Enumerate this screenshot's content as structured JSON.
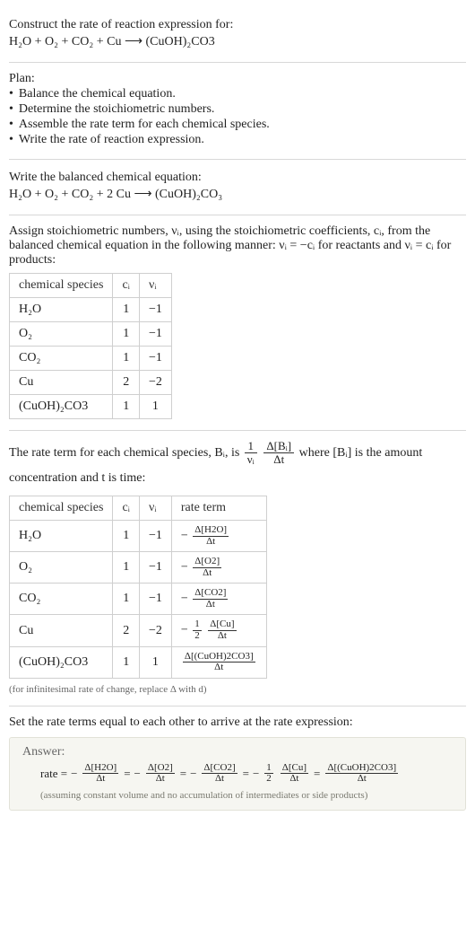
{
  "header": {
    "title": "Construct the rate of reaction expression for:",
    "equation": "H₂O + O₂ + CO₂ + Cu ⟶ (CuOH)₂CO3"
  },
  "plan": {
    "label": "Plan:",
    "items": [
      "Balance the chemical equation.",
      "Determine the stoichiometric numbers.",
      "Assemble the rate term for each chemical species.",
      "Write the rate of reaction expression."
    ]
  },
  "balanced": {
    "label": "Write the balanced chemical equation:",
    "equation": "H₂O + O₂ + CO₂ + 2 Cu ⟶ (CuOH)₂CO₃"
  },
  "stoich_intro": {
    "text_pre": "Assign stoichiometric numbers, νᵢ, using the stoichiometric coefficients, cᵢ, from the balanced chemical equation in the following manner: νᵢ = −cᵢ for reactants and νᵢ = cᵢ for products:"
  },
  "stoich_table": {
    "headers": [
      "chemical species",
      "cᵢ",
      "νᵢ"
    ],
    "rows": [
      {
        "species": "H₂O",
        "c": "1",
        "v": "−1"
      },
      {
        "species": "O₂",
        "c": "1",
        "v": "−1"
      },
      {
        "species": "CO₂",
        "c": "1",
        "v": "−1"
      },
      {
        "species": "Cu",
        "c": "2",
        "v": "−2"
      },
      {
        "species": "(CuOH)₂CO3",
        "c": "1",
        "v": "1"
      }
    ]
  },
  "rate_intro": {
    "pre": "The rate term for each chemical species, Bᵢ, is",
    "frac_left_n": "1",
    "frac_left_d": "νᵢ",
    "frac_right_n": "Δ[Bᵢ]",
    "frac_right_d": "Δt",
    "post": "where [Bᵢ] is the amount concentration and t is time:"
  },
  "rate_table": {
    "headers": [
      "chemical species",
      "cᵢ",
      "νᵢ",
      "rate term"
    ],
    "rows": [
      {
        "species": "H₂O",
        "c": "1",
        "v": "−1",
        "neg": "−",
        "half_n": "",
        "half_d": "",
        "n": "Δ[H2O]",
        "d": "Δt"
      },
      {
        "species": "O₂",
        "c": "1",
        "v": "−1",
        "neg": "−",
        "half_n": "",
        "half_d": "",
        "n": "Δ[O2]",
        "d": "Δt"
      },
      {
        "species": "CO₂",
        "c": "1",
        "v": "−1",
        "neg": "−",
        "half_n": "",
        "half_d": "",
        "n": "Δ[CO2]",
        "d": "Δt"
      },
      {
        "species": "Cu",
        "c": "2",
        "v": "−2",
        "neg": "−",
        "half_n": "1",
        "half_d": "2",
        "n": "Δ[Cu]",
        "d": "Δt"
      },
      {
        "species": "(CuOH)₂CO3",
        "c": "1",
        "v": "1",
        "neg": "",
        "half_n": "",
        "half_d": "",
        "n": "Δ[(CuOH)2CO3]",
        "d": "Δt"
      }
    ],
    "note": "(for infinitesimal rate of change, replace Δ with d)"
  },
  "final_intro": "Set the rate terms equal to each other to arrive at the rate expression:",
  "answer": {
    "label": "Answer:",
    "lead": "rate =",
    "terms": [
      {
        "neg": "−",
        "half_n": "",
        "half_d": "",
        "n": "Δ[H2O]",
        "d": "Δt"
      },
      {
        "neg": "−",
        "half_n": "",
        "half_d": "",
        "n": "Δ[O2]",
        "d": "Δt"
      },
      {
        "neg": "−",
        "half_n": "",
        "half_d": "",
        "n": "Δ[CO2]",
        "d": "Δt"
      },
      {
        "neg": "−",
        "half_n": "1",
        "half_d": "2",
        "n": "Δ[Cu]",
        "d": "Δt"
      },
      {
        "neg": "",
        "half_n": "",
        "half_d": "",
        "n": "Δ[(CuOH)2CO3]",
        "d": "Δt"
      }
    ],
    "eq": "=",
    "assumption": "(assuming constant volume and no accumulation of intermediates or side products)"
  },
  "chart_data": {
    "type": "table",
    "title": "Stoichiometric numbers and rate terms",
    "tables": [
      {
        "headers": [
          "chemical species",
          "c_i",
          "nu_i"
        ],
        "rows": [
          [
            "H2O",
            1,
            -1
          ],
          [
            "O2",
            1,
            -1
          ],
          [
            "CO2",
            1,
            -1
          ],
          [
            "Cu",
            2,
            -2
          ],
          [
            "(CuOH)2CO3",
            1,
            1
          ]
        ]
      },
      {
        "headers": [
          "chemical species",
          "c_i",
          "nu_i",
          "rate term"
        ],
        "rows": [
          [
            "H2O",
            1,
            -1,
            "-Δ[H2O]/Δt"
          ],
          [
            "O2",
            1,
            -1,
            "-Δ[O2]/Δt"
          ],
          [
            "CO2",
            1,
            -1,
            "-Δ[CO2]/Δt"
          ],
          [
            "Cu",
            2,
            -2,
            "-(1/2)Δ[Cu]/Δt"
          ],
          [
            "(CuOH)2CO3",
            1,
            1,
            "Δ[(CuOH)2CO3]/Δt"
          ]
        ]
      }
    ],
    "rate_expression": "rate = -Δ[H2O]/Δt = -Δ[O2]/Δt = -Δ[CO2]/Δt = -(1/2)Δ[Cu]/Δt = Δ[(CuOH)2CO3]/Δt"
  }
}
